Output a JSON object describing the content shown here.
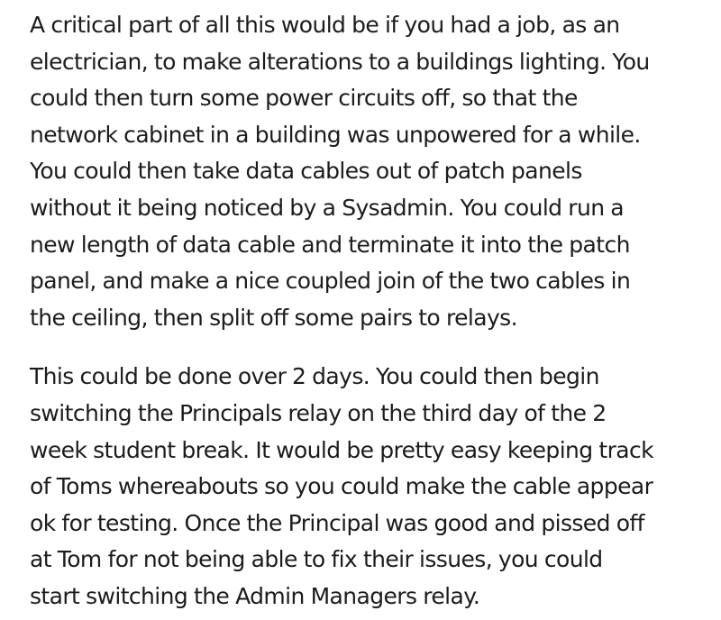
{
  "paragraphs": [
    {
      "lines": [
        "A critical part of all this would be if you had a job, as an",
        "electrician, to make alterations to a buildings lighting. You",
        "could then turn some power circuits off, so that the",
        "network cabinet in a building was unpowered for a while.",
        "You could then take data cables out of patch panels",
        "without it being noticed by a Sysadmin. You could run a",
        "new length of data cable and terminate it into the patch",
        "panel, and make a nice coupled join of the two cables in",
        "the ceiling, then split off some pairs to relays."
      ]
    },
    {
      "lines": [
        "This could be done over 2 days. You could then begin",
        "switching the Principals relay on the third day of the 2",
        "week student break. It would be pretty easy keeping track",
        "of Toms whereabouts so you could make the cable appear",
        "ok for testing. Once the Principal was good and pissed off",
        "at Tom for not being able to fix their issues, you could",
        "start switching the Admin Managers relay."
      ]
    }
  ]
}
